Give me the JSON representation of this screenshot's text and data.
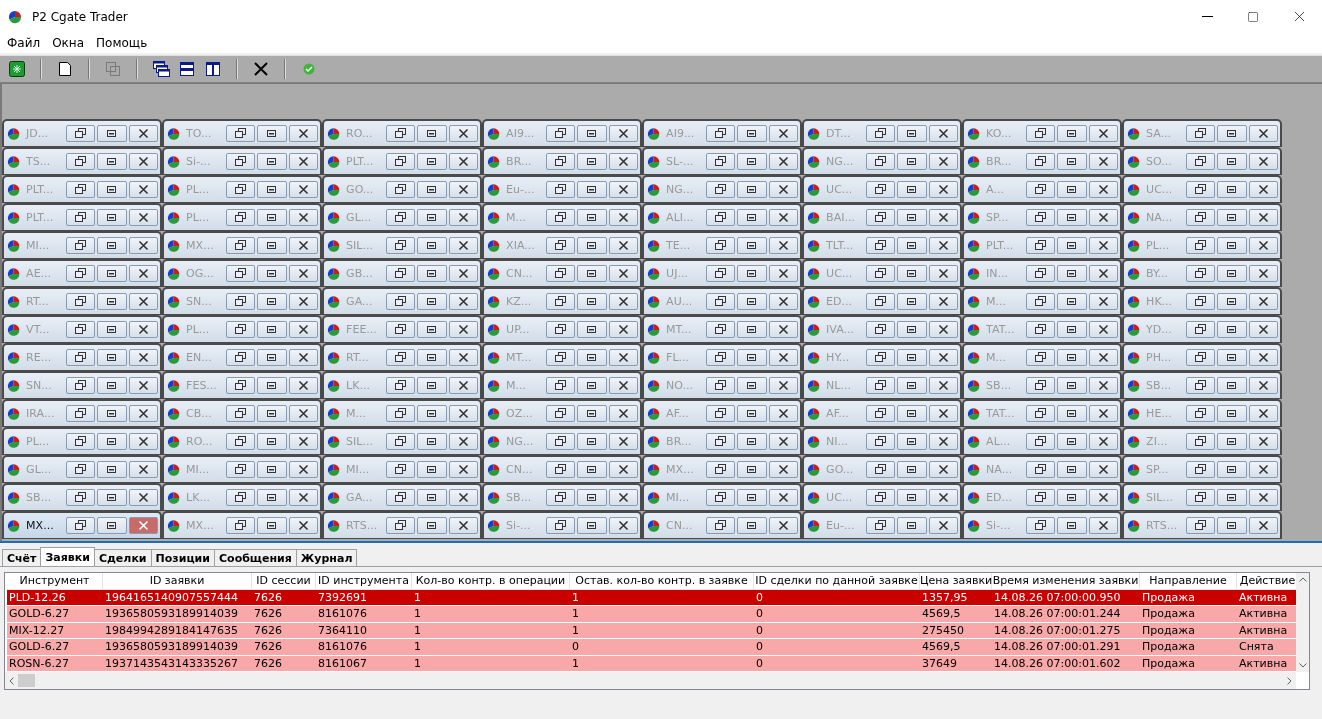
{
  "window": {
    "title": "P2 Cgate Trader"
  },
  "menu": [
    "Файл",
    "Окна",
    "Помощь"
  ],
  "toolbar": [
    {
      "kind": "connect",
      "disabled": false
    },
    {
      "kind": "new",
      "disabled": false
    },
    {
      "kind": "copy",
      "disabled": true
    },
    {
      "kind": "cascade",
      "disabled": false
    },
    {
      "kind": "tile-horizontal",
      "disabled": false
    },
    {
      "kind": "tile-vertical",
      "disabled": false
    },
    {
      "kind": "close-all",
      "disabled": false
    },
    {
      "kind": "status",
      "disabled": false
    }
  ],
  "mdi_windows": [
    {
      "title": "JD...",
      "active": false
    },
    {
      "title": "TO...",
      "active": false
    },
    {
      "title": "RO...",
      "active": false
    },
    {
      "title": "AI9...",
      "active": false
    },
    {
      "title": "AI9...",
      "active": false
    },
    {
      "title": "DT...",
      "active": false
    },
    {
      "title": "KO...",
      "active": false
    },
    {
      "title": "SA...",
      "active": false
    },
    {
      "title": "TS...",
      "active": false
    },
    {
      "title": "Si-...",
      "active": false
    },
    {
      "title": "PLT...",
      "active": false
    },
    {
      "title": "BR...",
      "active": false
    },
    {
      "title": "SL-...",
      "active": false
    },
    {
      "title": "NG...",
      "active": false
    },
    {
      "title": "BR...",
      "active": false
    },
    {
      "title": "SO...",
      "active": false
    },
    {
      "title": "PLT...",
      "active": false
    },
    {
      "title": "PL...",
      "active": false
    },
    {
      "title": "GO...",
      "active": false
    },
    {
      "title": "Eu-...",
      "active": false
    },
    {
      "title": "NG...",
      "active": false
    },
    {
      "title": "UC...",
      "active": false
    },
    {
      "title": "A...",
      "active": false
    },
    {
      "title": "UC...",
      "active": false
    },
    {
      "title": "PLT...",
      "active": false
    },
    {
      "title": "PL...",
      "active": false
    },
    {
      "title": "GL...",
      "active": false
    },
    {
      "title": "M...",
      "active": false
    },
    {
      "title": "ALI...",
      "active": false
    },
    {
      "title": "BAI...",
      "active": false
    },
    {
      "title": "SP...",
      "active": false
    },
    {
      "title": "NA...",
      "active": false
    },
    {
      "title": "MI...",
      "active": false
    },
    {
      "title": "MX...",
      "active": false
    },
    {
      "title": "SIL...",
      "active": false
    },
    {
      "title": "XIA...",
      "active": false
    },
    {
      "title": "TE...",
      "active": false
    },
    {
      "title": "TLT...",
      "active": false
    },
    {
      "title": "PLT...",
      "active": false
    },
    {
      "title": "PL...",
      "active": false
    },
    {
      "title": "AE...",
      "active": false
    },
    {
      "title": "OG...",
      "active": false
    },
    {
      "title": "GB...",
      "active": false
    },
    {
      "title": "CN...",
      "active": false
    },
    {
      "title": "UJ...",
      "active": false
    },
    {
      "title": "UC...",
      "active": false
    },
    {
      "title": "IN...",
      "active": false
    },
    {
      "title": "BY...",
      "active": false
    },
    {
      "title": "RT...",
      "active": false
    },
    {
      "title": "SN...",
      "active": false
    },
    {
      "title": "GA...",
      "active": false
    },
    {
      "title": "KZ...",
      "active": false
    },
    {
      "title": "AU...",
      "active": false
    },
    {
      "title": "ED...",
      "active": false
    },
    {
      "title": "M...",
      "active": false
    },
    {
      "title": "HK...",
      "active": false
    },
    {
      "title": "VT...",
      "active": false
    },
    {
      "title": "PL...",
      "active": false
    },
    {
      "title": "FEE...",
      "active": false
    },
    {
      "title": "UP...",
      "active": false
    },
    {
      "title": "MT...",
      "active": false
    },
    {
      "title": "IVA...",
      "active": false
    },
    {
      "title": "TAT...",
      "active": false
    },
    {
      "title": "YD...",
      "active": false
    },
    {
      "title": "RE...",
      "active": false
    },
    {
      "title": "EN...",
      "active": false
    },
    {
      "title": "RT...",
      "active": false
    },
    {
      "title": "MT...",
      "active": false
    },
    {
      "title": "FL...",
      "active": false
    },
    {
      "title": "HY...",
      "active": false
    },
    {
      "title": "M...",
      "active": false
    },
    {
      "title": "PH...",
      "active": false
    },
    {
      "title": "SN...",
      "active": false
    },
    {
      "title": "FES...",
      "active": false
    },
    {
      "title": "LK...",
      "active": false
    },
    {
      "title": "M...",
      "active": false
    },
    {
      "title": "NO...",
      "active": false
    },
    {
      "title": "NL...",
      "active": false
    },
    {
      "title": "SB...",
      "active": false
    },
    {
      "title": "SB...",
      "active": false
    },
    {
      "title": "IRA...",
      "active": false
    },
    {
      "title": "CB...",
      "active": false
    },
    {
      "title": "M...",
      "active": false
    },
    {
      "title": "OZ...",
      "active": false
    },
    {
      "title": "AF...",
      "active": false
    },
    {
      "title": "AF...",
      "active": false
    },
    {
      "title": "TAT...",
      "active": false
    },
    {
      "title": "HE...",
      "active": false
    },
    {
      "title": "PL...",
      "active": false
    },
    {
      "title": "RO...",
      "active": false
    },
    {
      "title": "SIL...",
      "active": false
    },
    {
      "title": "NG...",
      "active": false
    },
    {
      "title": "BR...",
      "active": false
    },
    {
      "title": "NI...",
      "active": false
    },
    {
      "title": "AL...",
      "active": false
    },
    {
      "title": "ZI...",
      "active": false
    },
    {
      "title": "GL...",
      "active": false
    },
    {
      "title": "MI...",
      "active": false
    },
    {
      "title": "MI...",
      "active": false
    },
    {
      "title": "CN...",
      "active": false
    },
    {
      "title": "MX...",
      "active": false
    },
    {
      "title": "GO...",
      "active": false
    },
    {
      "title": "NA...",
      "active": false
    },
    {
      "title": "SP...",
      "active": false
    },
    {
      "title": "SB...",
      "active": false
    },
    {
      "title": "LK...",
      "active": false
    },
    {
      "title": "GA...",
      "active": false
    },
    {
      "title": "SB...",
      "active": false
    },
    {
      "title": "MI...",
      "active": false
    },
    {
      "title": "UC...",
      "active": false
    },
    {
      "title": "ED...",
      "active": false
    },
    {
      "title": "SIL...",
      "active": false
    },
    {
      "title": "MX...",
      "active": true
    },
    {
      "title": "MX...",
      "active": false
    },
    {
      "title": "RTS...",
      "active": false
    },
    {
      "title": "Si-...",
      "active": false
    },
    {
      "title": "CN...",
      "active": false
    },
    {
      "title": "Eu-...",
      "active": false
    },
    {
      "title": "Si-...",
      "active": false
    },
    {
      "title": "RTS...",
      "active": false
    }
  ],
  "tabs": [
    {
      "label": "Счёт",
      "selected": false
    },
    {
      "label": "Заявки",
      "selected": true
    },
    {
      "label": "Сделки",
      "selected": false
    },
    {
      "label": "Позиции",
      "selected": false
    },
    {
      "label": "Сообщения",
      "selected": false
    },
    {
      "label": "Журнал",
      "selected": false
    }
  ],
  "table": {
    "columns": [
      "Инструмент",
      "ID заявки",
      "ID сессии",
      "ID инструмента",
      "Кол-во контр. в операции",
      "Остав. кол-во контр. в заявке",
      "ID сделки по данной заявке",
      "Цена заявки",
      "Время изменения заявки",
      "Направление",
      "Действие"
    ],
    "rows": [
      {
        "selected": true,
        "cells": [
          "PLD-12.26",
          "1964165140907557444",
          "7626",
          "7392691",
          "1",
          "1",
          "0",
          "1357,95",
          "14.08.26 07:00:00.950",
          "Продажа",
          "Активна"
        ]
      },
      {
        "selected": false,
        "cells": [
          "GOLD-6.27",
          "1936580593189914039",
          "7626",
          "8161076",
          "1",
          "1",
          "0",
          "4569,5",
          "14.08.26 07:00:01.244",
          "Продажа",
          "Активна"
        ]
      },
      {
        "selected": false,
        "cells": [
          "MIX-12.27",
          "1984994289184147635",
          "7626",
          "7364110",
          "1",
          "1",
          "0",
          "275450",
          "14.08.26 07:00:01.275",
          "Продажа",
          "Активна"
        ]
      },
      {
        "selected": false,
        "cells": [
          "GOLD-6.27",
          "1936580593189914039",
          "7626",
          "8161076",
          "1",
          "0",
          "0",
          "4569,5",
          "14.08.26 07:00:01.291",
          "Продажа",
          "Снята"
        ]
      },
      {
        "selected": false,
        "cells": [
          "ROSN-6.27",
          "1937143543143335267",
          "7626",
          "8161067",
          "1",
          "1",
          "0",
          "37649",
          "14.08.26 07:00:01.602",
          "Продажа",
          "Активна"
        ]
      }
    ]
  }
}
